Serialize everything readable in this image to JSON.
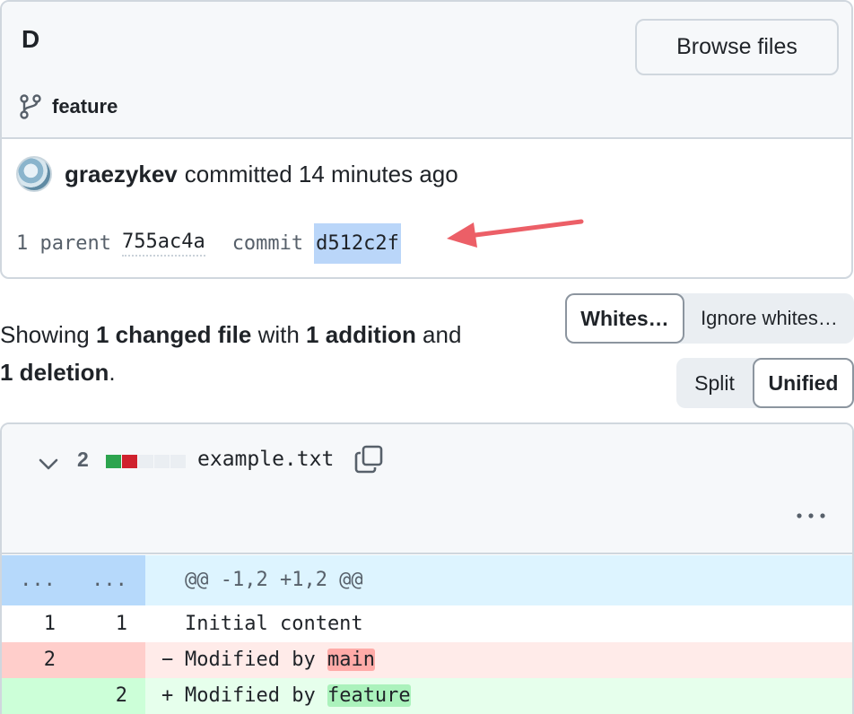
{
  "commit": {
    "title": "D",
    "browse_label": "Browse files",
    "branch": "feature",
    "author": "graezykev",
    "committed_text": "committed 14 minutes ago",
    "parent_label": "1 parent",
    "parent_sha": "755ac4a",
    "commit_label": "commit",
    "commit_sha": "d512c2f"
  },
  "summary": {
    "prefix": "Showing ",
    "changed": "1 changed file",
    "mid": " with ",
    "additions": "1 addition",
    "and": " and",
    "deletions": "1 deletion",
    "end": "."
  },
  "whitespace_toggle": {
    "option1": "Whites…",
    "option2": "Ignore whites…",
    "selected": "Whites…"
  },
  "view_toggle": {
    "option1": "Split",
    "option2": "Unified",
    "selected": "Unified"
  },
  "file": {
    "change_count": "2",
    "name": "example.txt",
    "diffstat_colors": [
      "#2da44e",
      "#cf222e",
      "#eaeef2",
      "#eaeef2",
      "#eaeef2"
    ],
    "hunk": {
      "old_num": "...",
      "new_num": "...",
      "header": "@@ -1,2 +1,2 @@"
    },
    "context_line": {
      "old_num": "1",
      "new_num": "1",
      "text": "Initial content"
    },
    "deleted_line": {
      "old_num": "2",
      "sign": "−",
      "text": "Modified by ",
      "highlight": "main"
    },
    "added_line": {
      "new_num": "2",
      "sign": "+",
      "text": "Modified by ",
      "highlight": "feature"
    }
  },
  "colors": {
    "accent_arrow": "#ec5f67",
    "sha_highlight": "#bad6f9"
  }
}
